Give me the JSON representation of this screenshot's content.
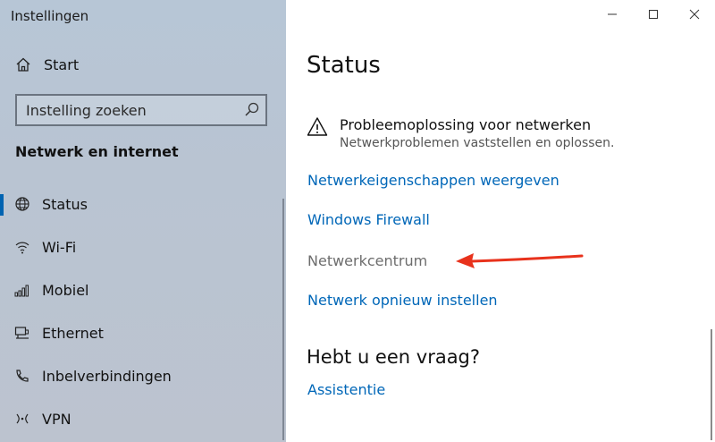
{
  "app": {
    "title": "Instellingen"
  },
  "sidebar": {
    "start_label": "Start",
    "search": {
      "placeholder": "Instelling zoeken",
      "value": ""
    },
    "section_title": "Netwerk en internet",
    "items": [
      {
        "label": "Status",
        "icon": "globe-icon",
        "active": true
      },
      {
        "label": "Wi-Fi",
        "icon": "wifi-icon",
        "active": false
      },
      {
        "label": "Mobiel",
        "icon": "cellular-signal-icon",
        "active": false
      },
      {
        "label": "Ethernet",
        "icon": "ethernet-icon",
        "active": false
      },
      {
        "label": "Inbelverbindingen",
        "icon": "dialup-icon",
        "active": false
      },
      {
        "label": "VPN",
        "icon": "vpn-icon",
        "active": false
      }
    ]
  },
  "window_controls": {
    "minimize": "minimize-icon",
    "maximize": "maximize-icon",
    "close": "close-icon"
  },
  "main": {
    "title": "Status",
    "troubleshoot": {
      "title": "Probleemoplossing voor netwerken",
      "subtitle": "Netwerkproblemen vaststellen en oplossen."
    },
    "links": [
      {
        "label": "Netwerkeigenschappen weergeven",
        "disabled": false
      },
      {
        "label": "Windows Firewall",
        "disabled": false
      },
      {
        "label": "Netwerkcentrum",
        "disabled": true
      },
      {
        "label": "Netwerk opnieuw instellen",
        "disabled": false
      }
    ],
    "question_title": "Hebt u een vraag?",
    "help_link": "Assistentie"
  },
  "annotation": {
    "arrow_color": "#e8321c"
  },
  "colors": {
    "accent": "#0067b8",
    "link": "#0067b8",
    "disabled_link": "#6d6d6d",
    "active_indicator": "#0063b1"
  }
}
